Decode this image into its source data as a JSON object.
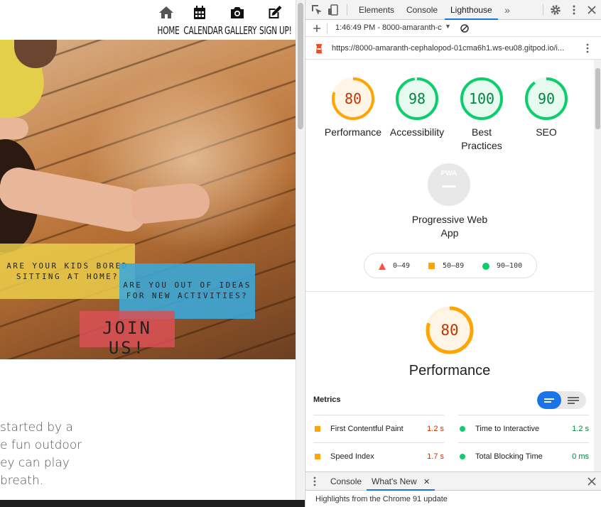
{
  "site": {
    "nav": [
      {
        "label": "HOME",
        "icon": "home-icon"
      },
      {
        "label": "CALENDAR",
        "icon": "calendar-icon"
      },
      {
        "label": "GALLERY",
        "icon": "camera-icon"
      },
      {
        "label": "SIGN UP!",
        "icon": "edit-icon"
      }
    ],
    "cards": {
      "yellow": [
        "Are your kids bored",
        "sitting at home?"
      ],
      "blue": [
        "Are you out of ideas",
        "for new activities?"
      ],
      "join": "Join us!"
    },
    "intro_lines": [
      "started by a",
      "e fun outdoor",
      "ey can play",
      "breath."
    ]
  },
  "devtools": {
    "tabs": [
      "Elements",
      "Console",
      "Lighthouse"
    ],
    "active_tab": "Lighthouse",
    "report_select": "1:46:49 PM - 8000-amaranth-c",
    "url": "https://8000-amaranth-cephalopod-01cma6h1.ws-eu08.gitpod.io/i...",
    "categories": [
      {
        "name": "Performance",
        "score": 80,
        "color": "#ffa400"
      },
      {
        "name": "Accessibility",
        "score": 98,
        "color": "#0cce6b"
      },
      {
        "name": "Best Practices",
        "score": 100,
        "color": "#0cce6b"
      },
      {
        "name": "SEO",
        "score": 90,
        "color": "#0cce6b"
      }
    ],
    "pwa": {
      "label": "Progressive Web App",
      "badge": "PWA"
    },
    "legend": [
      {
        "range": "0–49",
        "color": "#ff4e42"
      },
      {
        "range": "50–89",
        "color": "#ffa400"
      },
      {
        "range": "90–100",
        "color": "#0cce6b"
      }
    ],
    "performance": {
      "score": 80,
      "title": "Performance"
    },
    "metrics_title": "Metrics",
    "metrics": [
      {
        "name": "First Contentful Paint",
        "value": "1.2 s",
        "status": "average"
      },
      {
        "name": "Time to Interactive",
        "value": "1.2 s",
        "status": "pass"
      },
      {
        "name": "Speed Index",
        "value": "1.7 s",
        "status": "average"
      },
      {
        "name": "Total Blocking Time",
        "value": "0 ms",
        "status": "pass"
      }
    ],
    "drawer": {
      "tabs": [
        "Console",
        "What's New"
      ],
      "active": "What's New",
      "text": "Highlights from the Chrome 91 update"
    }
  }
}
